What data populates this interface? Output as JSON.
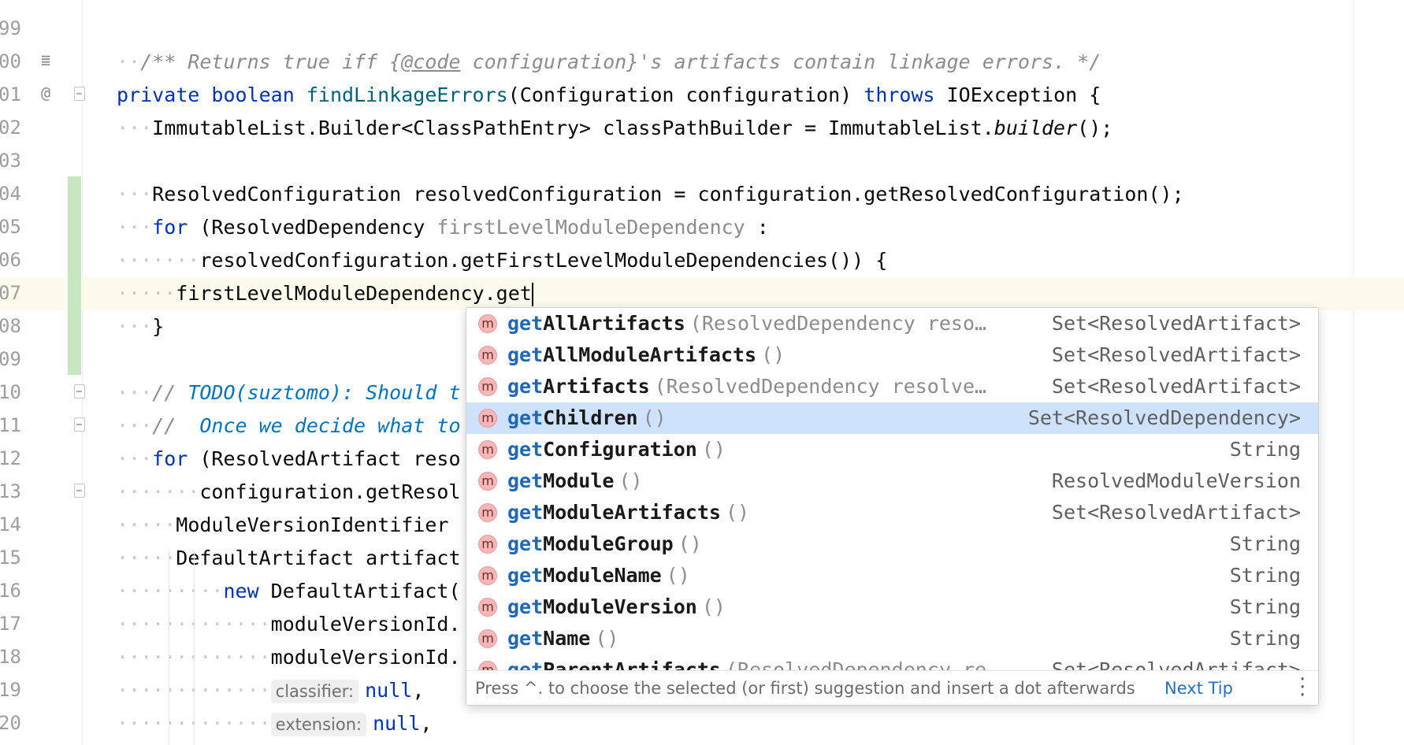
{
  "editor": {
    "lines": [
      {
        "num": "99"
      },
      {
        "num": "00",
        "parts": [
          {
            "t": "dots",
            "v": "··"
          },
          {
            "t": "cm",
            "v": "/** Returns true iff {"
          },
          {
            "t": "cmu",
            "v": "@code"
          },
          {
            "t": "cm",
            "v": " configuration}'s artifacts contain linkage errors. */"
          }
        ]
      },
      {
        "num": "01",
        "parts": [
          {
            "t": "kw",
            "v": "private"
          },
          {
            "t": "n",
            "v": " "
          },
          {
            "t": "kw",
            "v": "boolean"
          },
          {
            "t": "n",
            "v": " "
          },
          {
            "t": "fn",
            "v": "findLinkageErrors"
          },
          {
            "t": "n",
            "v": "(Configuration configuration) "
          },
          {
            "t": "kw",
            "v": "throws"
          },
          {
            "t": "n",
            "v": " IOException {"
          }
        ]
      },
      {
        "num": "02",
        "parts": [
          {
            "t": "dots",
            "v": "···"
          },
          {
            "t": "n",
            "v": "ImmutableList.Builder<ClassPathEntry> classPathBuilder = ImmutableList."
          },
          {
            "t": "it",
            "v": "builder"
          },
          {
            "t": "n",
            "v": "();"
          }
        ]
      },
      {
        "num": "03"
      },
      {
        "num": "04",
        "parts": [
          {
            "t": "dots",
            "v": "···"
          },
          {
            "t": "n",
            "v": "ResolvedConfiguration resolvedConfiguration = configuration.getResolvedConfiguration();"
          }
        ]
      },
      {
        "num": "05",
        "parts": [
          {
            "t": "dots",
            "v": "···"
          },
          {
            "t": "kw",
            "v": "for"
          },
          {
            "t": "n",
            "v": " (ResolvedDependency "
          },
          {
            "t": "param",
            "v": "firstLevelModuleDependency"
          },
          {
            "t": "n",
            "v": " :"
          }
        ]
      },
      {
        "num": "06",
        "parts": [
          {
            "t": "dots",
            "v": "·······"
          },
          {
            "t": "n",
            "v": "resolvedConfiguration.getFirstLevelModuleDependencies()) {"
          }
        ]
      },
      {
        "num": "07",
        "parts": [
          {
            "t": "dots",
            "v": "·····"
          },
          {
            "t": "n",
            "v": "firstLevelModuleDependency.get"
          },
          {
            "t": "caret",
            "v": ""
          }
        ]
      },
      {
        "num": "08",
        "parts": [
          {
            "t": "dots",
            "v": "···"
          },
          {
            "t": "n",
            "v": "}"
          }
        ]
      },
      {
        "num": "09"
      },
      {
        "num": "10",
        "parts": [
          {
            "t": "dots",
            "v": "···"
          },
          {
            "t": "cm",
            "v": "// "
          },
          {
            "t": "todo",
            "v": "TODO(suztomo): Should t"
          }
        ]
      },
      {
        "num": "11",
        "parts": [
          {
            "t": "dots",
            "v": "···"
          },
          {
            "t": "cm",
            "v": "//  "
          },
          {
            "t": "todo",
            "v": "Once we decide what to"
          }
        ]
      },
      {
        "num": "12",
        "parts": [
          {
            "t": "dots",
            "v": "···"
          },
          {
            "t": "kw",
            "v": "for"
          },
          {
            "t": "n",
            "v": " (ResolvedArtifact reso"
          }
        ]
      },
      {
        "num": "13",
        "parts": [
          {
            "t": "dots",
            "v": "·······"
          },
          {
            "t": "n",
            "v": "configuration.getResol"
          }
        ]
      },
      {
        "num": "14",
        "parts": [
          {
            "t": "dots",
            "v": "·····"
          },
          {
            "t": "n",
            "v": "ModuleVersionIdentifier"
          }
        ]
      },
      {
        "num": "15",
        "parts": [
          {
            "t": "dots",
            "v": "·····"
          },
          {
            "t": "n",
            "v": "DefaultArtifact artifact"
          }
        ]
      },
      {
        "num": "16",
        "parts": [
          {
            "t": "dots",
            "v": "·········"
          },
          {
            "t": "kw",
            "v": "new"
          },
          {
            "t": "n",
            "v": " DefaultArtifact("
          }
        ]
      },
      {
        "num": "17",
        "parts": [
          {
            "t": "dots",
            "v": "·············"
          },
          {
            "t": "n",
            "v": "moduleVersionId."
          }
        ]
      },
      {
        "num": "18",
        "parts": [
          {
            "t": "dots",
            "v": "·············"
          },
          {
            "t": "n",
            "v": "moduleVersionId."
          }
        ]
      },
      {
        "num": "19",
        "parts": [
          {
            "t": "dots",
            "v": "·············"
          },
          {
            "t": "hint",
            "v": "classifier:"
          },
          {
            "t": "kw",
            "v": "null"
          },
          {
            "t": "n",
            "v": ","
          }
        ]
      },
      {
        "num": "20",
        "parts": [
          {
            "t": "dots",
            "v": "·············"
          },
          {
            "t": "hint",
            "v": "extension:"
          },
          {
            "t": "kw",
            "v": "null"
          },
          {
            "t": "n",
            "v": ","
          }
        ]
      }
    ]
  },
  "completion": {
    "icon_label": "m",
    "icon": "method-icon",
    "items": [
      {
        "match": "get",
        "rest": "AllArtifacts",
        "params": "(ResolvedDependency reso…",
        "type": "Set<ResolvedArtifact>"
      },
      {
        "match": "get",
        "rest": "AllModuleArtifacts",
        "params": "()",
        "type": "Set<ResolvedArtifact>"
      },
      {
        "match": "get",
        "rest": "Artifacts",
        "params": "(ResolvedDependency resolve…",
        "type": "Set<ResolvedArtifact>"
      },
      {
        "match": "get",
        "rest": "Children",
        "params": "()",
        "type": "Set<ResolvedDependency>",
        "selected": true
      },
      {
        "match": "get",
        "rest": "Configuration",
        "params": "()",
        "type": "String"
      },
      {
        "match": "get",
        "rest": "Module",
        "params": "()",
        "type": "ResolvedModuleVersion"
      },
      {
        "match": "get",
        "rest": "ModuleArtifacts",
        "params": "()",
        "type": "Set<ResolvedArtifact>"
      },
      {
        "match": "get",
        "rest": "ModuleGroup",
        "params": "()",
        "type": "String"
      },
      {
        "match": "get",
        "rest": "ModuleName",
        "params": "()",
        "type": "String"
      },
      {
        "match": "get",
        "rest": "ModuleVersion",
        "params": "()",
        "type": "String"
      },
      {
        "match": "get",
        "rest": "Name",
        "params": "()",
        "type": "String"
      },
      {
        "match": "get",
        "rest": "ParentArtifacts",
        "params": "(ResolvedDependency re…",
        "type": "Set<ResolvedArtifact>"
      }
    ],
    "footer_tip": "Press ^. to choose the selected (or first) suggestion and insert a dot afterwards",
    "next_tip": "Next Tip",
    "more_icon": "more-vertical-icon"
  },
  "colors": {
    "accent": "#2068b6",
    "selection": "#cfe2fb",
    "current_line": "#fcfaed",
    "change_bar": "#c9e6c3"
  }
}
